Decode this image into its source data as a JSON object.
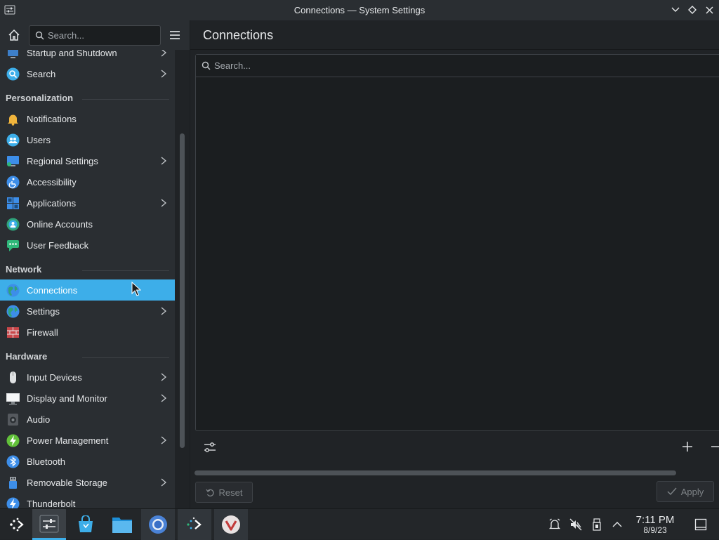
{
  "window": {
    "title": "Connections — System Settings"
  },
  "sidebar": {
    "search_placeholder": "Search...",
    "items": [
      {
        "type": "item",
        "label": "Startup and Shutdown",
        "icon": "startup-icon",
        "chevron": true,
        "color": "#3d7fc9"
      },
      {
        "type": "item",
        "label": "Search",
        "icon": "search-icon",
        "chevron": true,
        "color": "#3daee9"
      },
      {
        "type": "header",
        "label": "Personalization"
      },
      {
        "type": "item",
        "label": "Notifications",
        "icon": "bell-icon",
        "chevron": false,
        "color": "#f0b43c"
      },
      {
        "type": "item",
        "label": "Users",
        "icon": "users-icon",
        "chevron": false,
        "color": "#3daee9"
      },
      {
        "type": "item",
        "label": "Regional Settings",
        "icon": "regional-icon",
        "chevron": true,
        "color": "#3d8ee9"
      },
      {
        "type": "item",
        "label": "Accessibility",
        "icon": "accessibility-icon",
        "chevron": false,
        "color": "#3d8ee9"
      },
      {
        "type": "item",
        "label": "Applications",
        "icon": "applications-icon",
        "chevron": true,
        "color": "#3d8ee9"
      },
      {
        "type": "item",
        "label": "Online Accounts",
        "icon": "online-accounts-icon",
        "chevron": false,
        "color": "#2fa37a"
      },
      {
        "type": "item",
        "label": "User Feedback",
        "icon": "feedback-icon",
        "chevron": false,
        "color": "#2fb77a"
      },
      {
        "type": "header",
        "label": "Network"
      },
      {
        "type": "item",
        "label": "Connections",
        "icon": "connections-icon",
        "chevron": false,
        "active": true,
        "color": "#2fa37a"
      },
      {
        "type": "item",
        "label": "Settings",
        "icon": "network-settings-icon",
        "chevron": true,
        "color": "#3d8ee9"
      },
      {
        "type": "item",
        "label": "Firewall",
        "icon": "firewall-icon",
        "chevron": false,
        "color": "#c9474a"
      },
      {
        "type": "header",
        "label": "Hardware"
      },
      {
        "type": "item",
        "label": "Input Devices",
        "icon": "mouse-icon",
        "chevron": true,
        "color": "#dfe1e3"
      },
      {
        "type": "item",
        "label": "Display and Monitor",
        "icon": "display-icon",
        "chevron": true,
        "color": "#dfe1e3"
      },
      {
        "type": "item",
        "label": "Audio",
        "icon": "audio-icon",
        "chevron": false,
        "color": "#55595e"
      },
      {
        "type": "item",
        "label": "Power Management",
        "icon": "power-icon",
        "chevron": true,
        "color": "#62c13a"
      },
      {
        "type": "item",
        "label": "Bluetooth",
        "icon": "bluetooth-icon",
        "chevron": false,
        "color": "#3d8ee9"
      },
      {
        "type": "item",
        "label": "Removable Storage",
        "icon": "usb-icon",
        "chevron": true,
        "color": "#3d8ee9"
      },
      {
        "type": "item",
        "label": "Thunderbolt",
        "icon": "thunderbolt-icon",
        "chevron": false,
        "color": "#3d8ee9"
      }
    ]
  },
  "main": {
    "title": "Connections",
    "search_placeholder": "Search...",
    "reset_label": "Reset",
    "apply_label": "Apply"
  },
  "taskbar": {
    "time": "7:11 PM",
    "date": "8/9/23"
  },
  "colors": {
    "accent": "#3daee9",
    "background": "#202326",
    "sidebar": "#2a2e32"
  }
}
